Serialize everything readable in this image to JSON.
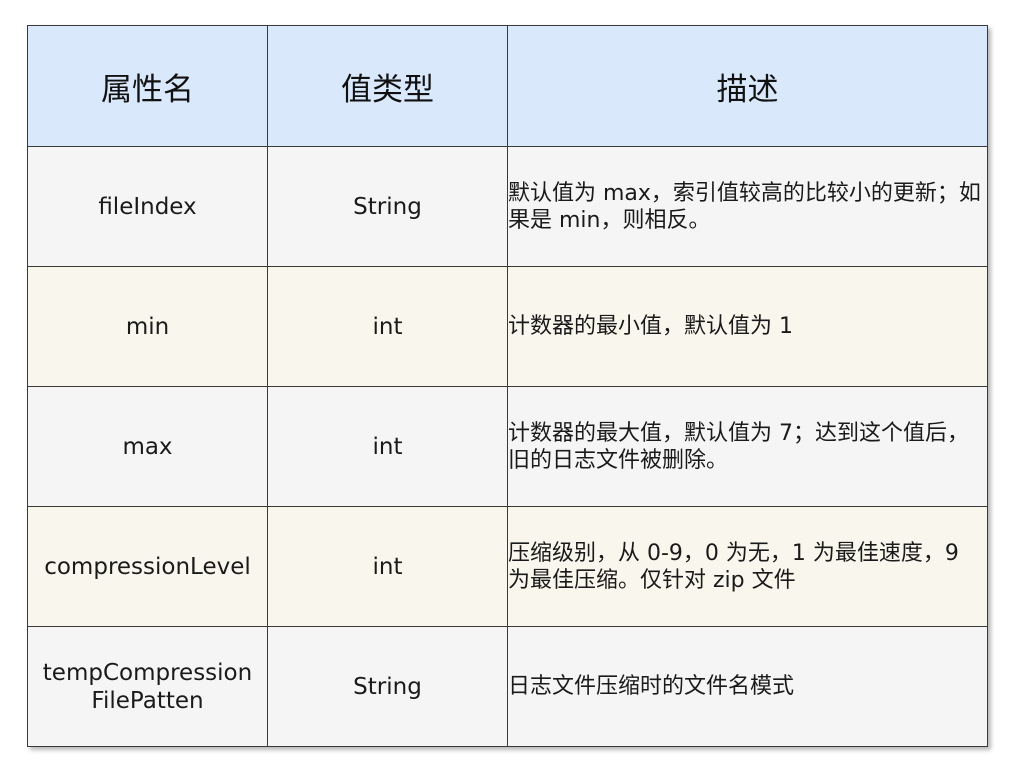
{
  "colors": {
    "header_bg": "#dae8fc",
    "row_gray": "#f5f5f5",
    "row_beige": "#f9f7ed",
    "border": "#3a3a3a"
  },
  "headers": {
    "name": "属性名",
    "type": "值类型",
    "desc": "描述"
  },
  "rows": [
    {
      "name": "fileIndex",
      "type": "String",
      "desc": "默认值为 max，索引值较高的比较小的更新；如果是 min，则相反。",
      "bg": "#f5f5f5"
    },
    {
      "name": "min",
      "type": "int",
      "desc": "计数器的最小值，默认值为 1",
      "bg": "#f9f7ed"
    },
    {
      "name": "max",
      "type": "int",
      "desc": "计数器的最大值，默认值为 7；达到这个值后，旧的日志文件被删除。",
      "bg": "#f5f5f5"
    },
    {
      "name": "compressionLevel",
      "type": "int",
      "desc": "压缩级别，从 0-9，0 为无，1 为最佳速度，9 为最佳压缩。仅针对 zip 文件",
      "bg": "#f9f7ed"
    },
    {
      "name_lines": [
        "tempCompression",
        "FilePatten"
      ],
      "type": "String",
      "desc": "日志文件压缩时的文件名模式",
      "bg": "#f5f5f5"
    }
  ]
}
